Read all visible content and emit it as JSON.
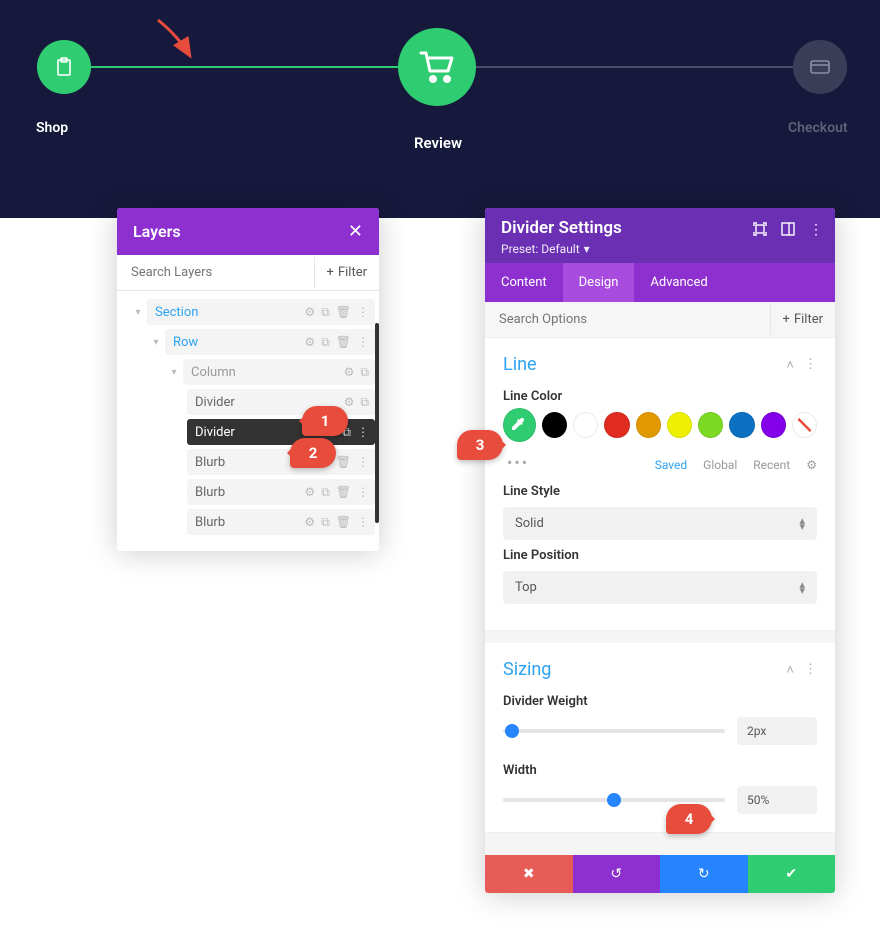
{
  "header": {
    "steps": [
      {
        "label": "Shop",
        "icon": "clipboard-icon",
        "state": "done"
      },
      {
        "label": "Review",
        "icon": "cart-icon",
        "state": "active"
      },
      {
        "label": "Checkout",
        "icon": "card-icon",
        "state": "upcoming"
      }
    ]
  },
  "callouts": {
    "c1": "1",
    "c2": "2",
    "c3": "3",
    "c4": "4"
  },
  "layers": {
    "title": "Layers",
    "search_placeholder": "Search Layers",
    "filter_label": "Filter",
    "tree": {
      "section": "Section",
      "row": "Row",
      "column": "Column",
      "items": [
        "Divider",
        "Divider",
        "Blurb",
        "Blurb",
        "Blurb"
      ],
      "active_index": 1
    }
  },
  "settings": {
    "title": "Divider Settings",
    "preset": "Preset: Default",
    "tabs": {
      "content": "Content",
      "design": "Design",
      "advanced": "Advanced",
      "active": "design"
    },
    "search_placeholder": "Search Options",
    "filter_label": "Filter",
    "line": {
      "section_title": "Line",
      "color_label": "Line Color",
      "colors": [
        "#2fcc71",
        "#000000",
        "#ffffff",
        "#e02b20",
        "#e09900",
        "#edf000",
        "#7cda24",
        "#0c71c3",
        "#8300e9",
        "none"
      ],
      "active_color_index": 0,
      "color_tabs": {
        "saved": "Saved",
        "global": "Global",
        "recent": "Recent"
      },
      "style_label": "Line Style",
      "style_value": "Solid",
      "position_label": "Line Position",
      "position_value": "Top"
    },
    "sizing": {
      "section_title": "Sizing",
      "weight_label": "Divider Weight",
      "weight_value": "2px",
      "weight_percent": 4,
      "width_label": "Width",
      "width_value": "50%",
      "width_percent": 50
    },
    "footer": {
      "cancel": "cancel",
      "undo": "undo",
      "redo": "redo",
      "save": "save"
    }
  }
}
